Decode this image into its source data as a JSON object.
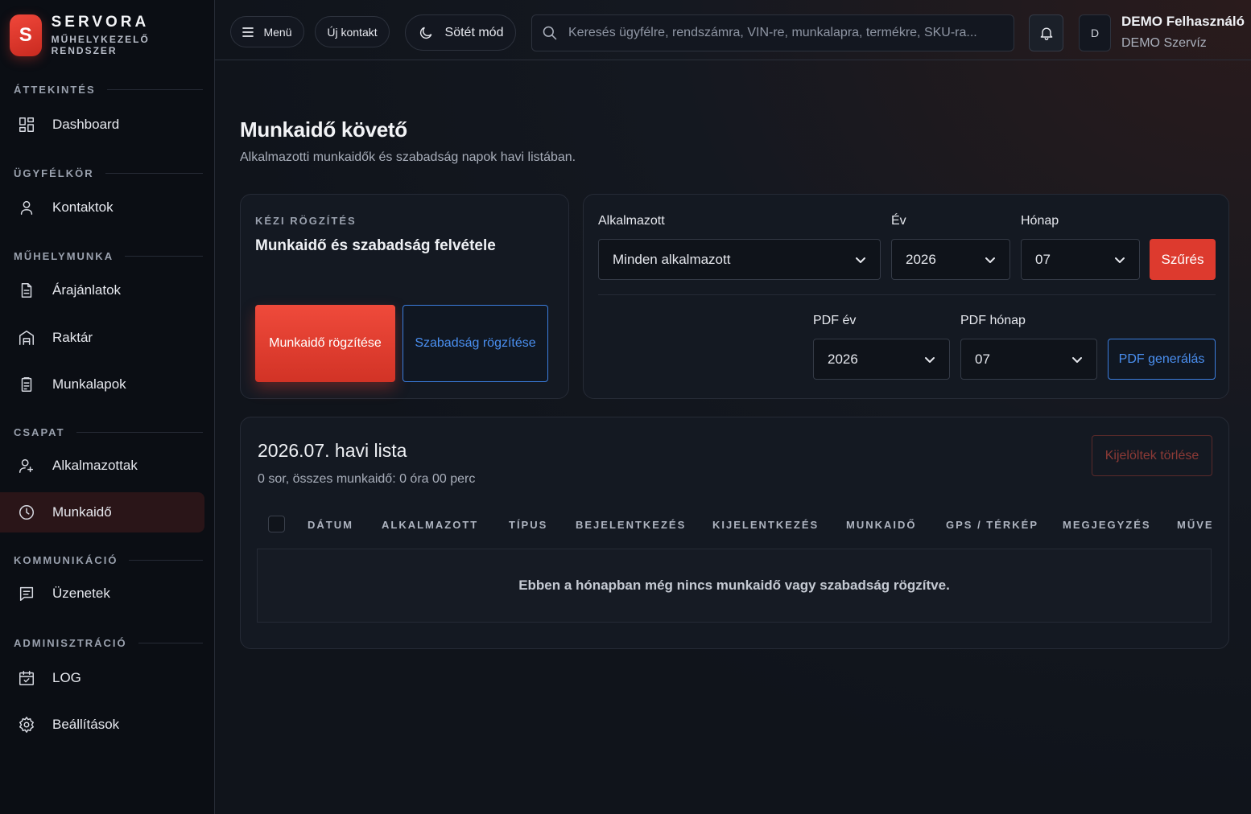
{
  "brand": {
    "logo_letter": "S",
    "name": "SERVORA",
    "subtitle": "MŰHELYKEZELŐ RENDSZER"
  },
  "sidebar": {
    "sections": [
      {
        "title": "ÁTTEKINTÉS",
        "items": [
          {
            "label": "Dashboard",
            "icon": "dashboard-icon"
          }
        ]
      },
      {
        "title": "ÜGYFÉLKÖR",
        "items": [
          {
            "label": "Kontaktok",
            "icon": "user-icon"
          }
        ]
      },
      {
        "title": "MŰHELYMUNKA",
        "items": [
          {
            "label": "Árajánlatok",
            "icon": "document-icon"
          },
          {
            "label": "Raktár",
            "icon": "warehouse-icon"
          },
          {
            "label": "Munkalapok",
            "icon": "clipboard-icon"
          }
        ]
      },
      {
        "title": "CSAPAT",
        "items": [
          {
            "label": "Alkalmazottak",
            "icon": "user-plus-icon"
          },
          {
            "label": "Munkaidő",
            "icon": "clock-icon",
            "active": true
          }
        ]
      },
      {
        "title": "KOMMUNIKÁCIÓ",
        "items": [
          {
            "label": "Üzenetek",
            "icon": "message-icon"
          }
        ]
      },
      {
        "title": "ADMINISZTRÁCIÓ",
        "items": [
          {
            "label": "LOG",
            "icon": "calendar-icon"
          },
          {
            "label": "Beállítások",
            "icon": "gear-icon"
          }
        ]
      }
    ]
  },
  "topbar": {
    "menu_label": "Menü",
    "new_contact_label": "Új kontakt",
    "dark_mode_label": "Sötét mód",
    "search_placeholder": "Keresés ügyfélre, rendszámra, VIN-re, munkalapra, termékre, SKU-ra...",
    "avatar_initial": "D",
    "user_name": "DEMO Felhasználó",
    "user_org": "DEMO Szervíz"
  },
  "page": {
    "title": "Munkaidő követő",
    "subtitle": "Alkalmazotti munkaidők és szabadság napok havi listában."
  },
  "manual_entry": {
    "eyebrow": "KÉZI RÖGZÍTÉS",
    "title": "Munkaidő és szabadság felvétele",
    "record_work_label": "Munkaidő rögzítése",
    "record_leave_label": "Szabadság rögzítése"
  },
  "filters": {
    "employee_label": "Alkalmazott",
    "employee_value": "Minden alkalmazott",
    "year_label": "Év",
    "year_value": "2026",
    "month_label": "Hónap",
    "month_value": "07",
    "filter_button": "Szűrés",
    "pdf_year_label": "PDF év",
    "pdf_year_value": "2026",
    "pdf_month_label": "PDF hónap",
    "pdf_month_value": "07",
    "pdf_button": "PDF generálás"
  },
  "list": {
    "title": "2026.07. havi lista",
    "summary": "0 sor, összes munkaidő: 0 óra 00 perc",
    "delete_selected": "Kijelöltek törlése",
    "columns": [
      "DÁTUM",
      "ALKALMAZOTT",
      "TÍPUS",
      "BEJELENTKEZÉS",
      "KIJELENTKEZÉS",
      "MUNKAIDŐ",
      "GPS / TÉRKÉP",
      "MEGJEGYZÉS",
      "MŰVEI"
    ],
    "empty_message": "Ebben a hónapban még nincs munkaidő vagy szabadság rögzítve."
  },
  "colors": {
    "accent_red": "#dd3a2e",
    "accent_blue": "#3b7ddd",
    "background": "#0d1017"
  }
}
